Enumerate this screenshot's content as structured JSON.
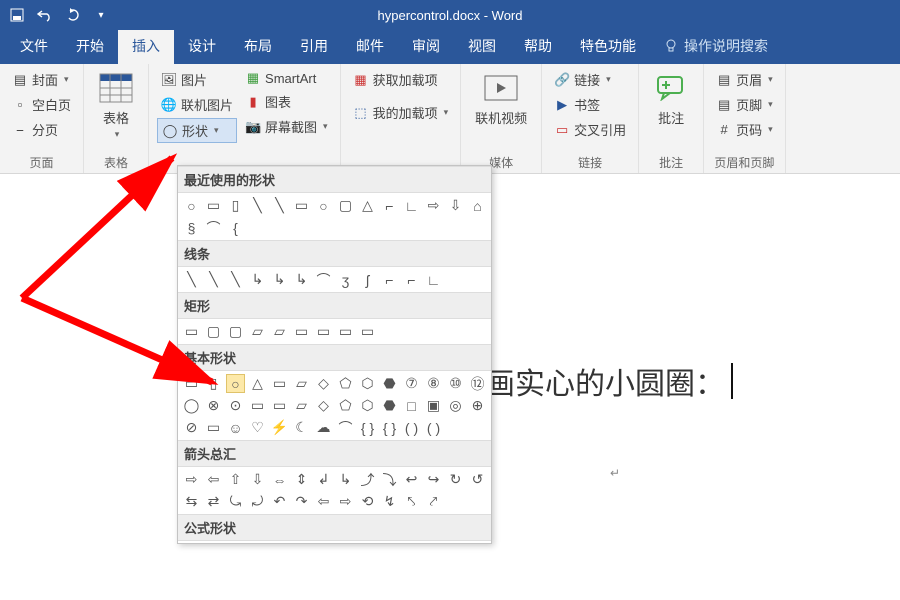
{
  "titlebar": {
    "title": "hypercontrol.docx - Word"
  },
  "tabs": {
    "file": "文件",
    "home": "开始",
    "insert": "插入",
    "design": "设计",
    "layout": "布局",
    "references": "引用",
    "mailings": "邮件",
    "review": "审阅",
    "view": "视图",
    "help": "帮助",
    "special": "特色功能",
    "tellme": "操作说明搜索"
  },
  "ribbon": {
    "pages": {
      "label": "页面",
      "cover": "封面",
      "blank": "空白页",
      "break": "分页"
    },
    "tables": {
      "label": "表格",
      "btn": "表格"
    },
    "illustrations": {
      "pictures": "图片",
      "online_pic": "联机图片",
      "shapes": "形状",
      "smartart": "SmartArt",
      "chart": "图表",
      "screenshot": "屏幕截图"
    },
    "addins": {
      "get": "获取加载项",
      "my": "我的加载项"
    },
    "media": {
      "label": "媒体",
      "video": "联机视频"
    },
    "links": {
      "label": "链接",
      "link": "链接",
      "bookmark": "书签",
      "crossref": "交叉引用"
    },
    "comments": {
      "label": "批注",
      "btn": "批注"
    },
    "headerfooter": {
      "label": "页眉和页脚",
      "header": "页眉",
      "footer": "页脚",
      "pagenum": "页码"
    }
  },
  "dropdown": {
    "recent": "最近使用的形状",
    "lines": "线条",
    "rects": "矩形",
    "basic": "基本形状",
    "arrows": "箭头总汇",
    "formula": "公式形状"
  },
  "document": {
    "body": "画实心的小圆圈："
  },
  "shapes": {
    "recent": [
      "○",
      "▭",
      "▯",
      "╲",
      "╲",
      "▭",
      "○",
      "▢",
      "△",
      "⌐",
      "∟",
      "⇨",
      "⇩",
      "⌂",
      "§",
      "⌒",
      "{"
    ],
    "lines": [
      "╲",
      "╲",
      "╲",
      "↳",
      "↳",
      "↳",
      "⌒",
      "ʒ",
      "ʃ",
      "⌐",
      "⌐",
      "∟"
    ],
    "rects": [
      "▭",
      "▢",
      "▢",
      "▱",
      "▱",
      "▭",
      "▭",
      "▭",
      "▭"
    ],
    "basic": [
      "▭",
      "▯",
      "○",
      "△",
      "▭",
      "▱",
      "◇",
      "⬠",
      "⬡",
      "⬣",
      "⑦",
      "⑧",
      "⑩",
      "⑫",
      "◯",
      "⊗",
      "⊙",
      "▭",
      "▭",
      "▱",
      "◇",
      "⬠",
      "⬡",
      "⬣",
      "□",
      "▣",
      "◎",
      "⊕",
      "⊘",
      "▭",
      "☺",
      "♡",
      "⚡",
      "☾",
      "☁",
      "⌒",
      "{ }",
      "{ }",
      "( )",
      "( )"
    ],
    "arrows": [
      "⇨",
      "⇦",
      "⇧",
      "⇩",
      "⇔",
      "⇕",
      "↲",
      "↳",
      "⤴",
      "⤵",
      "↩",
      "↪",
      "↻",
      "↺",
      "⇆",
      "⇄",
      "⤿",
      "⤾",
      "↶",
      "↷",
      "⇦",
      "⇨",
      "⟲",
      "↯",
      "⤣",
      "⤤"
    ]
  }
}
